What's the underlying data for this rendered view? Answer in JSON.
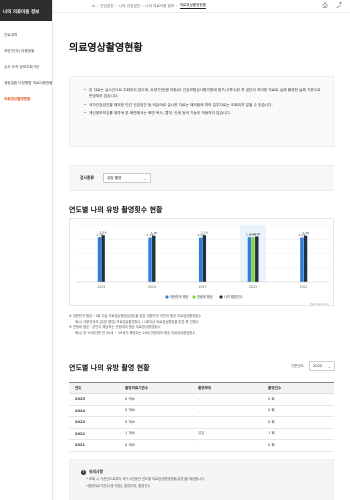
{
  "sidebar": {
    "header": "나의 의료이용 정보",
    "items": [
      {
        "label": "진료내역",
        "active": false
      },
      {
        "label": "처방전(약) 이용현황",
        "active": false
      },
      {
        "label": "심사 도착 정보조회기안",
        "active": false
      },
      {
        "label": "생동질환 다정병원 의료이용현황",
        "active": false
      },
      {
        "label": "의료영상촬영현황",
        "active": true
      }
    ]
  },
  "breadcrumb": [
    "건강검진",
    "나의 건강검진",
    "나의 의료이용 정보",
    "의료영상촬영현황"
  ],
  "page_title": "의료영상촬영현황",
  "notice": [
    "본 자료는 실시간으로 조회되지 않으며, 요양기관(병·의원)이 건강보험심사평가원에 청구(사후3)한 후 공단이 처리한 자료로 실제 촬영한 날짜 기준으로 반영되어 있습니다.",
    "국가건강검진을 제외한 민간 건강검진 등 비급여로 실시한 자료는 제외됨에 따라 일부자료는 조회되지 않을 수 있습니다.",
    "개인정보보호를 위하여 본 화면에서는 화면 복사, 캡처, 인쇄 등의 기능이 작동하지 않습니다."
  ],
  "filter": {
    "label": "검사종류",
    "selected": "유방 촬영"
  },
  "chart_section_title": "연도별 나의 유방 촬영횟수 현황",
  "chart_data": {
    "type": "bar",
    "categories": [
      "2025",
      "2024",
      "2023",
      "2022",
      "2021"
    ],
    "series": [
      {
        "name": "대한민국 평균",
        "color": "#2f7de1",
        "values": [
          1.14,
          1.13,
          1.13,
          1.14,
          1.13
        ]
      },
      {
        "name": "연령대 평균",
        "color": "#8bd33a",
        "values": [
          null,
          null,
          null,
          1.14,
          null
        ]
      },
      {
        "name": "나의 촬영건수",
        "color": "#1f2f45",
        "values": [
          1.19,
          1.18,
          1.19,
          1.16,
          1.18
        ]
      }
    ],
    "value_labels": [
      [
        "1.14",
        "",
        "1.16"
      ],
      [
        "1.13",
        "",
        "1.18"
      ],
      [
        "1.13",
        "",
        "1.19"
      ],
      [
        "1.14",
        "1.14",
        "1.16"
      ],
      [
        "1.13",
        "",
        "1.18"
      ]
    ],
    "ylim": [
      0,
      1.45
    ],
    "grid": true,
    "legend": "bottom",
    "highlight_category": "2022",
    "source": "Highcharts.com"
  },
  "chart_notes": [
    "※ 대한민국 평균 : 1회 이상 의료영상촬영(유방)을 받은 대한민국 국민의 평균 의료영상촬영횟수",
    "예시) 대한민국의 [유방 촬영] 의료영상촬영횟수 / 1회이상 의료영상촬영을 받은 총 인원수",
    "※ 연령대 평균 : 본인이 해당하는 연령대의 평균 의료영상촬영횟수",
    "예시) 만 54세이면 만 50세 ~ 59세가 해당되는 50대 연령대의 평균 의료영상촬영횟수"
  ],
  "table_section_title": "연도별 나의 유방 촬영 현황",
  "year_filter": {
    "label": "기준년도",
    "selected": "2025"
  },
  "table": {
    "columns": [
      "연도",
      "촬영의료기관수",
      "촬영부위",
      "촬영건수"
    ],
    "rows": [
      [
        "2025",
        "0 개소",
        "-",
        "0 회"
      ],
      [
        "2024",
        "0 개소",
        "-",
        "0 회"
      ],
      [
        "2023",
        "0 개소",
        "-",
        "0 회"
      ],
      [
        "2022",
        "1 개소",
        "유방",
        "1 회"
      ],
      [
        "2021",
        "0 개소",
        "-",
        "0 회"
      ]
    ]
  },
  "info_box": {
    "title": "유의사항",
    "lines": [
      "• 조회 시 기준년도로부터 과거 5년동안 연도별 의료영상촬영현황(유방)을 제공합니다.",
      "•촬영의료기관수(명 의원), 촬영부위, 촬영건수"
    ]
  }
}
